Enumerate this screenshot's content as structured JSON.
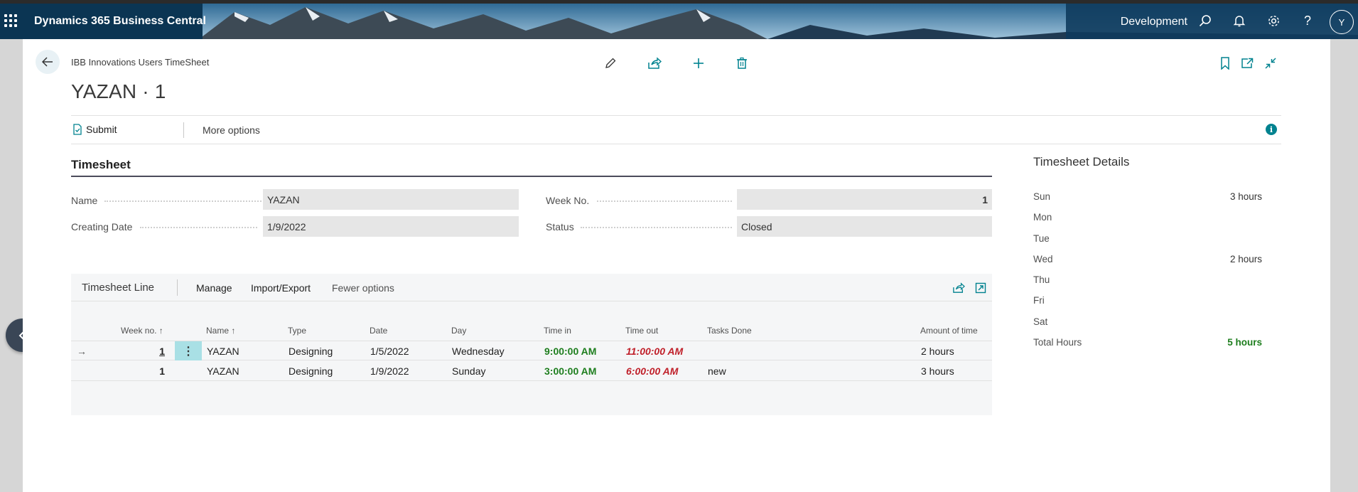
{
  "topbar": {
    "app_title": "Dynamics 365 Business Central",
    "environment": "Development",
    "avatar_initial": "Y",
    "icons": [
      "search-icon",
      "bell-icon",
      "gear-icon",
      "help-icon"
    ]
  },
  "page": {
    "breadcrumb": "IBB Innovations Users TimeSheet",
    "title": "YAZAN · 1",
    "actions": [
      "edit-icon",
      "share-icon",
      "new-icon",
      "delete-icon",
      "bookmark-icon",
      "open-new-window-icon",
      "collapse-icon"
    ]
  },
  "command_bar": {
    "submit": "Submit",
    "more_options": "More options",
    "info": "i"
  },
  "timesheet": {
    "section_title": "Timesheet",
    "name_label": "Name",
    "name_value": "YAZAN",
    "creating_date_label": "Creating Date",
    "creating_date_value": "1/9/2022",
    "week_no_label": "Week No.",
    "week_no_value": "1",
    "status_label": "Status",
    "status_value": "Closed"
  },
  "lines": {
    "title": "Timesheet Line",
    "menu": [
      "Manage",
      "Import/Export",
      "Fewer options"
    ],
    "columns": {
      "week_no": "Week no. ↑",
      "name": "Name ↑",
      "type": "Type",
      "date": "Date",
      "day": "Day",
      "time_in": "Time in",
      "time_out": "Time out",
      "tasks_done": "Tasks Done",
      "amount": "Amount of time"
    },
    "rows": [
      {
        "week_no": "1",
        "name": "YAZAN",
        "type": "Designing",
        "date": "1/5/2022",
        "day": "Wednesday",
        "time_in": "9:00:00 AM",
        "time_out": "11:00:00 AM",
        "tasks_done": "",
        "amount": "2 hours"
      },
      {
        "week_no": "1",
        "name": "YAZAN",
        "type": "Designing",
        "date": "1/9/2022",
        "day": "Sunday",
        "time_in": "3:00:00 AM",
        "time_out": "6:00:00 AM",
        "tasks_done": "new",
        "amount": "3 hours"
      }
    ]
  },
  "factbox": {
    "title": "Timesheet Details",
    "items": [
      {
        "label": "Sun",
        "value": "3 hours"
      },
      {
        "label": "Mon",
        "value": ""
      },
      {
        "label": "Tue",
        "value": ""
      },
      {
        "label": "Wed",
        "value": "2 hours"
      },
      {
        "label": "Thu",
        "value": ""
      },
      {
        "label": "Fri",
        "value": ""
      },
      {
        "label": "Sat",
        "value": ""
      },
      {
        "label": "Total Hours",
        "value": "5 hours"
      }
    ]
  },
  "colors": {
    "accent": "#00828f",
    "time_in": "#1e7e1e",
    "time_out": "#c0202a"
  }
}
